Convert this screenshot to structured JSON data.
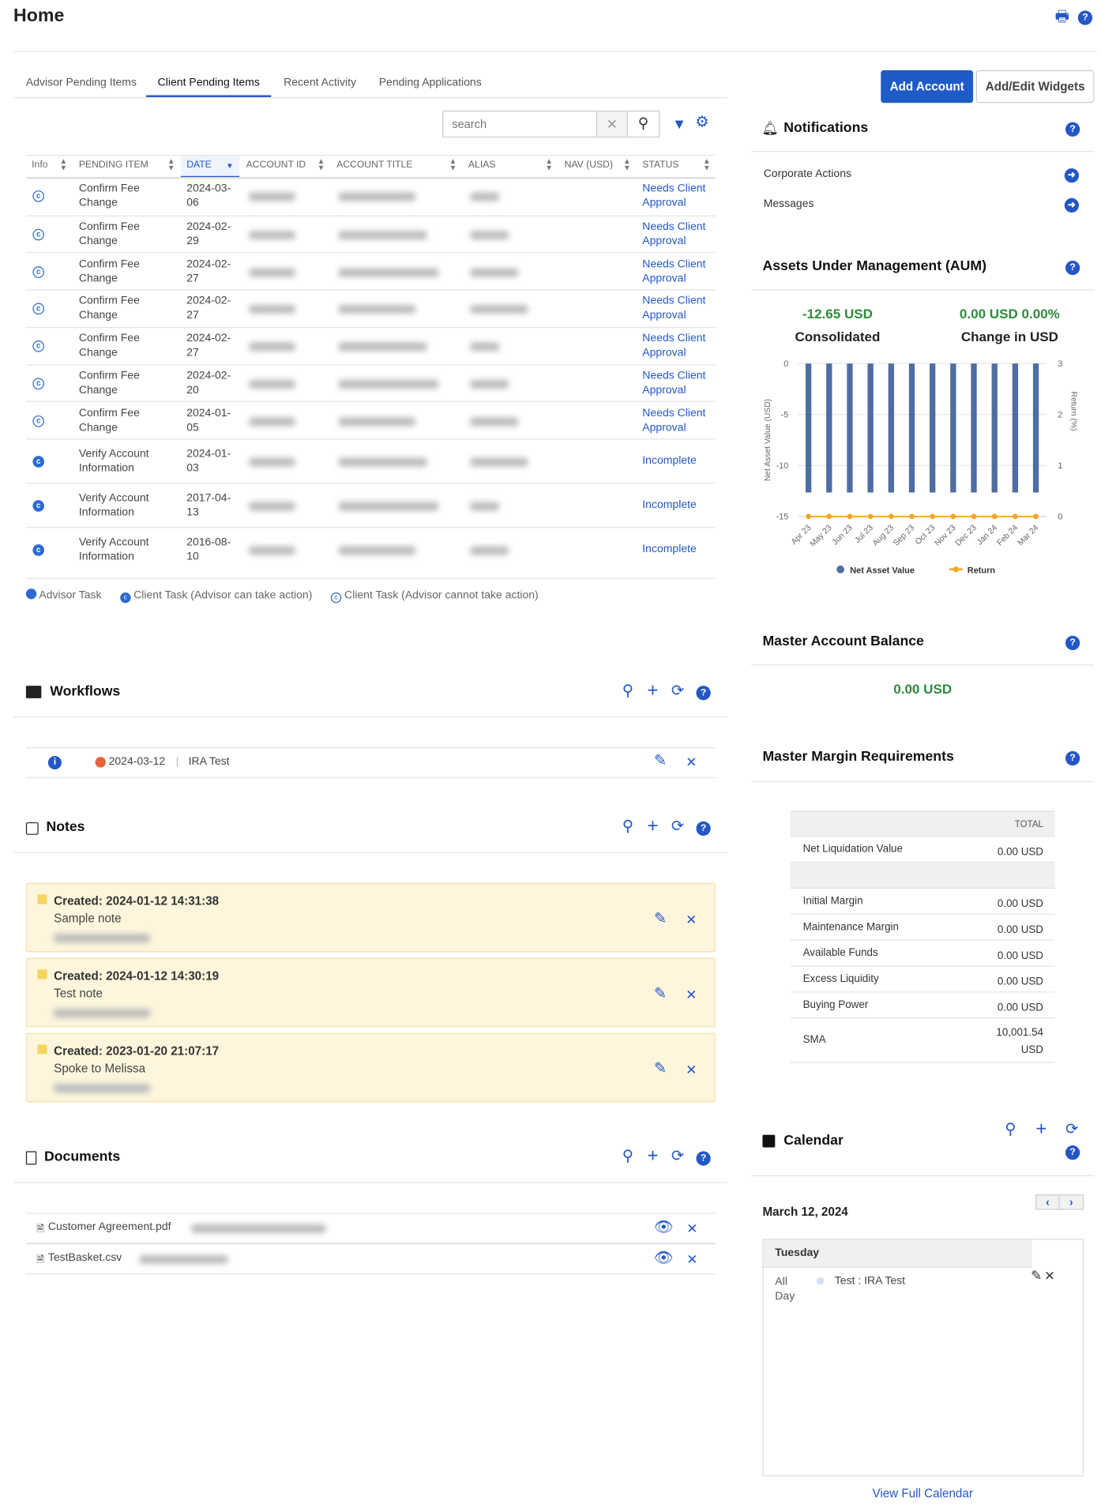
{
  "header": {
    "title": "Home",
    "print_icon": "print-icon",
    "help_icon": "help-icon"
  },
  "tabs": [
    {
      "label": "Advisor Pending Items",
      "active": false
    },
    {
      "label": "Client Pending Items",
      "active": true
    },
    {
      "label": "Recent Activity",
      "active": false
    },
    {
      "label": "Pending Applications",
      "active": false
    }
  ],
  "actions": {
    "add_account": "Add Account",
    "add_edit_widgets": "Add/Edit Widgets"
  },
  "search": {
    "placeholder": "search",
    "value": ""
  },
  "table": {
    "columns": [
      "Info",
      "PENDING ITEM",
      "DATE",
      "ACCOUNT ID",
      "ACCOUNT TITLE",
      "ALIAS",
      "NAV (USD)",
      "STATUS"
    ],
    "sorted_column": "DATE",
    "rows": [
      {
        "type": "client-cannot",
        "item": "Confirm Fee Change",
        "date": "2024-03-06",
        "status": "Needs Client Approval"
      },
      {
        "type": "client-cannot",
        "item": "Confirm Fee Change",
        "date": "2024-02-29",
        "status": "Needs Client Approval"
      },
      {
        "type": "client-cannot",
        "item": "Confirm Fee Change",
        "date": "2024-02-27",
        "status": "Needs Client Approval"
      },
      {
        "type": "client-cannot",
        "item": "Confirm Fee Change",
        "date": "2024-02-27",
        "status": "Needs Client Approval"
      },
      {
        "type": "client-cannot",
        "item": "Confirm Fee Change",
        "date": "2024-02-27",
        "status": "Needs Client Approval"
      },
      {
        "type": "client-cannot",
        "item": "Confirm Fee Change",
        "date": "2024-02-20",
        "status": "Needs Client Approval"
      },
      {
        "type": "client-cannot",
        "item": "Confirm Fee Change",
        "date": "2024-01-05",
        "status": "Needs Client Approval"
      },
      {
        "type": "client-can",
        "item": "Verify Account Information",
        "date": "2024-01-03",
        "status": "Incomplete"
      },
      {
        "type": "client-can",
        "item": "Verify Account Information",
        "date": "2017-04-13",
        "status": "Incomplete"
      },
      {
        "type": "client-can",
        "item": "Verify Account Information",
        "date": "2016-08-10",
        "status": "Incomplete"
      }
    ]
  },
  "legend": {
    "advisor": "Advisor Task",
    "client_can": "Client Task (Advisor can take action)",
    "client_cannot": "Client Task (Advisor cannot take action)"
  },
  "workflows": {
    "title": "Workflows",
    "items": [
      {
        "date": "2024-03-12",
        "name": "IRA Test",
        "status_color": "#e8643c"
      }
    ]
  },
  "notes": {
    "title": "Notes",
    "items": [
      {
        "created": "Created: 2024-01-12 14:31:38",
        "text": "Sample note"
      },
      {
        "created": "Created: 2024-01-12 14:30:19",
        "text": "Test note"
      },
      {
        "created": "Created: 2023-01-20 21:07:17",
        "text": "Spoke to Melissa"
      }
    ]
  },
  "documents": {
    "title": "Documents",
    "items": [
      {
        "name": "Customer Agreement.pdf"
      },
      {
        "name": "TestBasket.csv"
      }
    ]
  },
  "notifications": {
    "title": "Notifications",
    "items": [
      "Corporate Actions",
      "Messages"
    ]
  },
  "aum": {
    "title": "Assets Under Management (AUM)",
    "consolidated_value": "-12.65 USD",
    "consolidated_label": "Consolidated",
    "change_value": "0.00 USD 0.00%",
    "change_label": "Change in USD",
    "positive_color": "#2e8b3a"
  },
  "chart_data": {
    "type": "bar",
    "categories": [
      "Apr 23",
      "May 23",
      "Jun 23",
      "Jul 23",
      "Aug 23",
      "Sep 23",
      "Oct 23",
      "Nov 23",
      "Dec 23",
      "Jan 24",
      "Feb 24",
      "Mar 24"
    ],
    "series": [
      {
        "name": "Net Asset Value",
        "type": "bar",
        "axis": "left",
        "color": "#4f6ca3",
        "values": [
          -12.65,
          -12.65,
          -12.65,
          -12.65,
          -12.65,
          -12.65,
          -12.65,
          -12.65,
          -12.65,
          -12.65,
          -12.65,
          -12.65
        ]
      },
      {
        "name": "Return",
        "type": "line",
        "axis": "right",
        "color": "#f5a623",
        "values": [
          0,
          0,
          0,
          0,
          0,
          0,
          0,
          0,
          0,
          0,
          0,
          0
        ]
      }
    ],
    "ylabel": "Net Asset Value (USD)",
    "y2label": "Return (%)",
    "ylim": [
      -15,
      0
    ],
    "y2lim": [
      0,
      3
    ],
    "yticks": [
      "0",
      "-5",
      "-10",
      "-15"
    ],
    "y2ticks": [
      "3",
      "2",
      "1",
      "0"
    ],
    "grid": true,
    "legend": "bottom"
  },
  "master_balance": {
    "title": "Master Account Balance",
    "value": "0.00 USD"
  },
  "margin": {
    "title": "Master Margin Requirements",
    "header": "TOTAL",
    "rows": [
      {
        "label": "Net Liquidation Value",
        "value": "0.00 USD"
      },
      {
        "label": "",
        "value": ""
      },
      {
        "label": "Initial Margin",
        "value": "0.00 USD"
      },
      {
        "label": "Maintenance Margin",
        "value": "0.00 USD"
      },
      {
        "label": "Available Funds",
        "value": "0.00 USD"
      },
      {
        "label": "Excess Liquidity",
        "value": "0.00 USD"
      },
      {
        "label": "Buying Power",
        "value": "0.00 USD"
      },
      {
        "label": "SMA",
        "value": "10,001.54 USD"
      }
    ]
  },
  "calendar": {
    "title": "Calendar",
    "date": "March 12, 2024",
    "day": "Tuesday",
    "events": [
      {
        "time": "All Day",
        "text": "Test : IRA Test"
      }
    ],
    "view_full": "View Full Calendar"
  }
}
